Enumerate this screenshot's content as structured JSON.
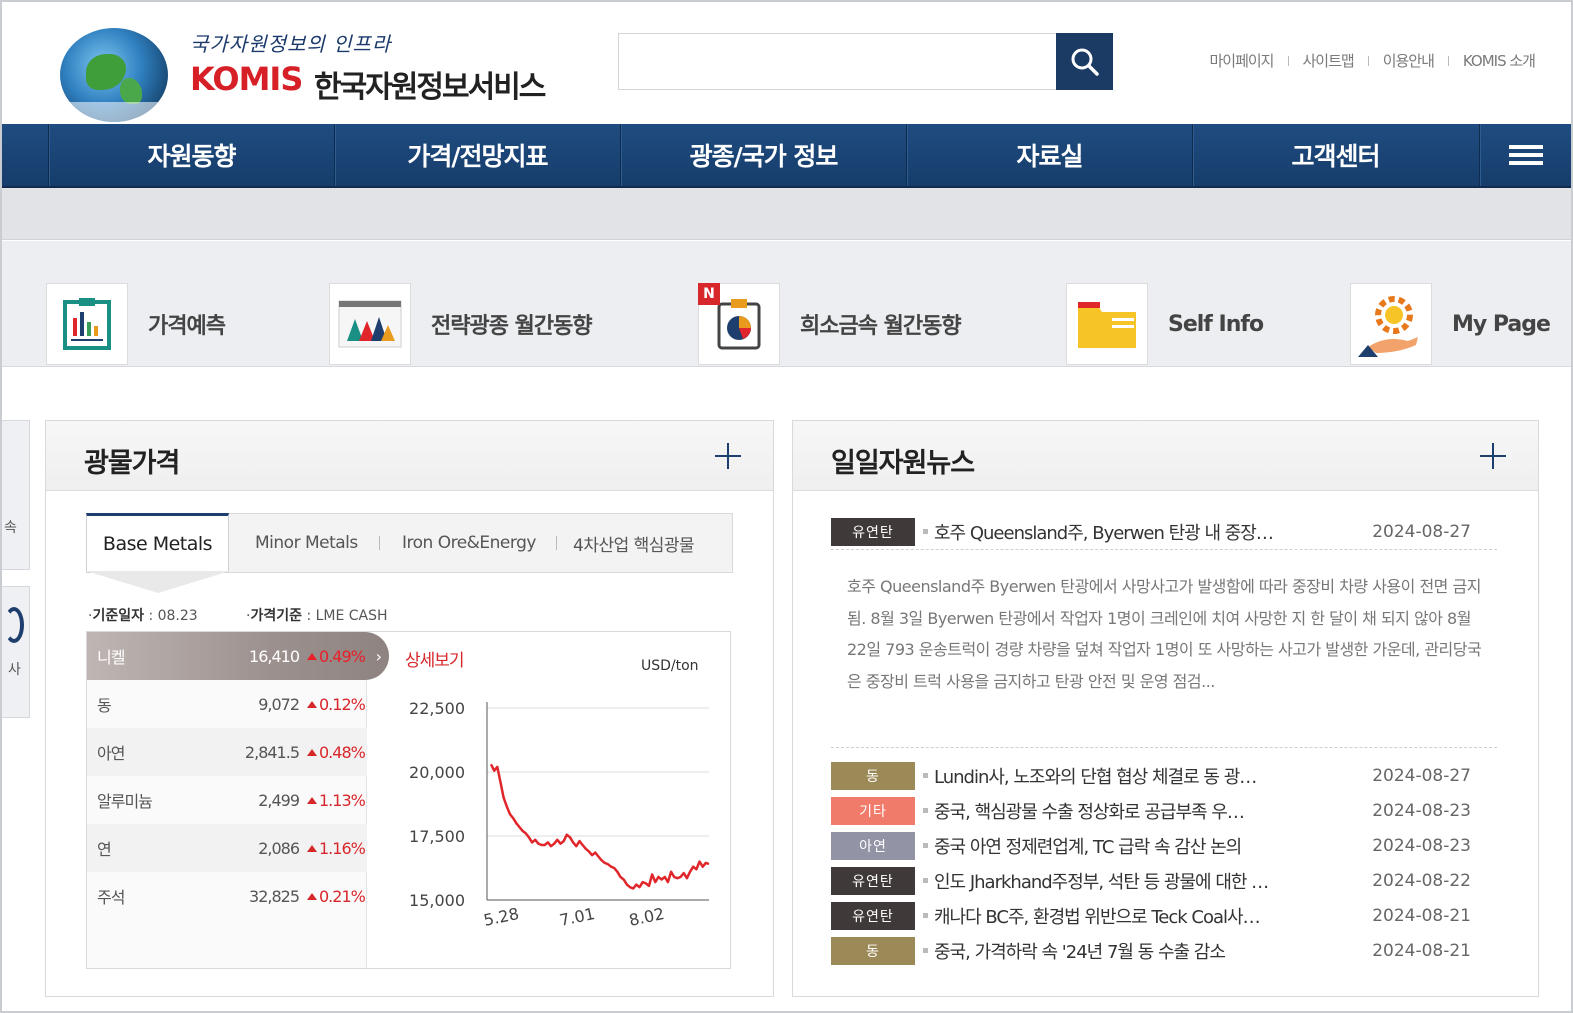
{
  "header": {
    "slogan": "국가자원정보의 인프라",
    "brand": "KOMIS",
    "brand_kr": "한국자원정보서비스",
    "search_placeholder": "",
    "util_links": [
      "마이페이지",
      "사이트맵",
      "이용안내",
      "KOMIS 소개"
    ]
  },
  "nav": {
    "items": [
      "자원동향",
      "가격/전망지표",
      "광종/국가 정보",
      "자료실",
      "고객센터"
    ]
  },
  "quick_links": [
    {
      "label": "가격예측",
      "icon": "price-forecast-icon"
    },
    {
      "label": "전략광종 월간동향",
      "icon": "bar-chart-icon"
    },
    {
      "label": "희소금속 월간동향",
      "icon": "pie-clipboard-icon",
      "badge": "N"
    },
    {
      "label": "Self Info",
      "icon": "folder-icon"
    },
    {
      "label": "My Page",
      "icon": "gear-bulb-icon"
    }
  ],
  "mineral_prices": {
    "title": "광물가격",
    "tabs": [
      "Base Metals",
      "Minor Metals",
      "Iron Ore&Energy",
      "4차산업 핵심광물"
    ],
    "active_tab": "Base Metals",
    "base_date_label": "기준일자",
    "base_date": "08.23",
    "price_basis_label": "가격기준",
    "price_basis": "LME CASH",
    "rows": [
      {
        "name": "니켈",
        "value": "16,410",
        "change": "0.49%"
      },
      {
        "name": "동",
        "value": "9,072",
        "change": "0.12%"
      },
      {
        "name": "아연",
        "value": "2,841.5",
        "change": "0.48%"
      },
      {
        "name": "알루미늄",
        "value": "2,499",
        "change": "1.13%"
      },
      {
        "name": "연",
        "value": "2,086",
        "change": "1.16%"
      },
      {
        "name": "주석",
        "value": "32,825",
        "change": "0.21%"
      }
    ],
    "detail_link": "상세보기",
    "unit": "USD/ton"
  },
  "chart_data": {
    "type": "line",
    "title": "",
    "xlabel": "",
    "ylabel": "",
    "unit": "USD/ton",
    "x_ticks": [
      "5.28",
      "7.01",
      "8.02"
    ],
    "y_ticks": [
      22500,
      20000,
      17500,
      15000
    ],
    "ylim": [
      15000,
      22500
    ],
    "series": [
      {
        "color": "#e0262b",
        "x": [
          0,
          1,
          2,
          3,
          4,
          5,
          6,
          7,
          8,
          9,
          10,
          11,
          12,
          13,
          14,
          15,
          16,
          17,
          18,
          19,
          20,
          21,
          22,
          23,
          24,
          25,
          26,
          27,
          28,
          29,
          30,
          31,
          32,
          33,
          34,
          35,
          36,
          37,
          38,
          39,
          40,
          41,
          42,
          43,
          44,
          45,
          46,
          47,
          48,
          49,
          50,
          51,
          52,
          53,
          54,
          55,
          56,
          57,
          58,
          59,
          60,
          61,
          62,
          63,
          64,
          65,
          66,
          67,
          68,
          69
        ],
        "values": [
          20300,
          20050,
          20200,
          19600,
          19000,
          18650,
          18350,
          18200,
          18000,
          17850,
          17700,
          17600,
          17450,
          17250,
          17350,
          17200,
          17150,
          17150,
          17250,
          17100,
          17200,
          17350,
          17200,
          17300,
          17550,
          17450,
          17250,
          17100,
          17300,
          17150,
          17000,
          16900,
          16750,
          16850,
          16700,
          16550,
          16450,
          16400,
          16300,
          16250,
          16100,
          15900,
          15800,
          15600,
          15500,
          15450,
          15600,
          15500,
          15700,
          15650,
          15550,
          16000,
          15700,
          15900,
          15800,
          15900,
          15700,
          16100,
          15900,
          15850,
          15900,
          16050,
          15850,
          16100,
          16300,
          16200,
          16500,
          16300,
          16450,
          16410
        ]
      }
    ]
  },
  "daily_news": {
    "title": "일일자원뉴스",
    "featured": {
      "tag": "유연탄",
      "tag_color": "#3f3a39",
      "title": "호주 Queensland주, Byerwen 탄광 내 중장…",
      "date": "2024-08-27",
      "summary": "호주 Queensland주 Byerwen 탄광에서 사망사고가 발생함에 따라 중장비 차량 사용이 전면 금지됨. 8월 3일 Byerwen 탄광에서 작업자 1명이 크레인에 치여 사망한 지 한 달이 채 되지 않아 8월 22일 793 운송트럭이 경량 차량을 덮쳐 작업자 1명이 또 사망하는 사고가 발생한 가운데, 관리당국은 중장비 트럭 사용을 금지하고 탄광 안전 및 운영 점검..."
    },
    "items": [
      {
        "tag": "동",
        "tag_color": "#9b8a57",
        "title": "Lundin사, 노조와의 단협 협상 체결로 동 광…",
        "date": "2024-08-27"
      },
      {
        "tag": "기타",
        "tag_color": "#f07b6b",
        "title": "중국, 핵심광물 수출 정상화로 공급부족 우…",
        "date": "2024-08-23"
      },
      {
        "tag": "아연",
        "tag_color": "#9294a6",
        "title": "중국 아연 정제련업계, TC 급락 속 감산 논의",
        "date": "2024-08-23"
      },
      {
        "tag": "유연탄",
        "tag_color": "#3f3a39",
        "title": "인도 Jharkhand주정부, 석탄 등 광물에 대한 …",
        "date": "2024-08-22"
      },
      {
        "tag": "유연탄",
        "tag_color": "#3f3a39",
        "title": "캐나다 BC주, 환경법 위반으로 Teck Coal사…",
        "date": "2024-08-21"
      },
      {
        "tag": "동",
        "tag_color": "#9b8a57",
        "title": "중국, 가격하락 속 '24년 7월 동 수출 감소",
        "date": "2024-08-21"
      }
    ]
  },
  "colors": {
    "nav_bg": "#1b4577",
    "accent_red": "#d7272b",
    "search_btn": "#1b3a64"
  }
}
